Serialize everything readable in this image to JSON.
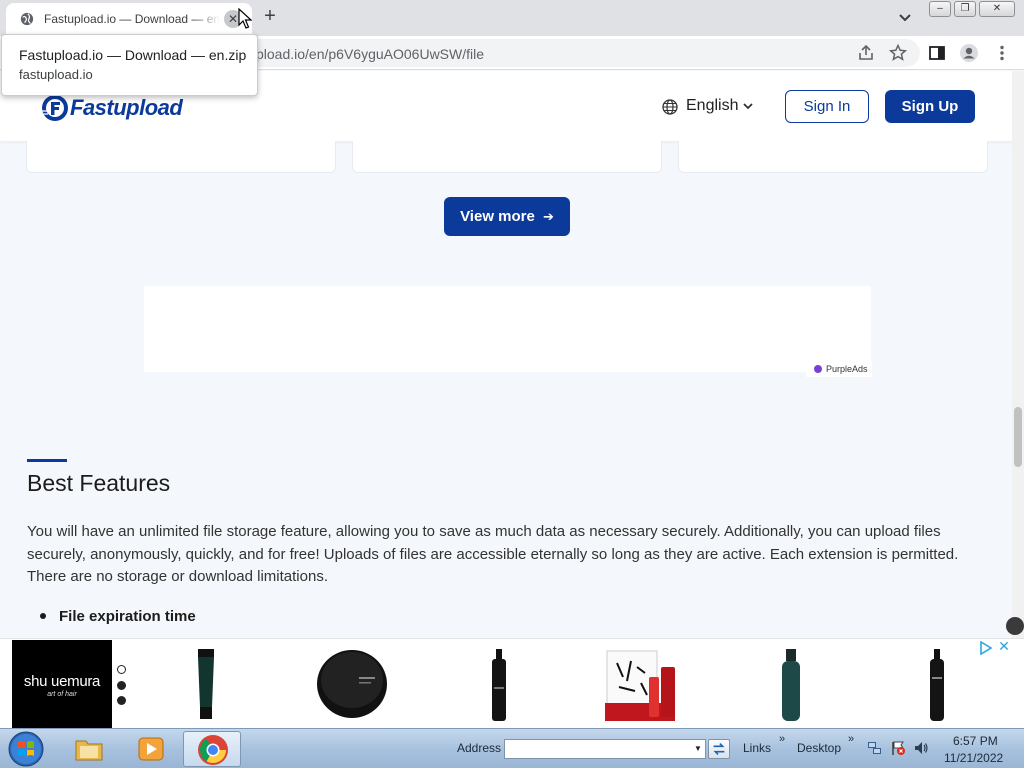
{
  "browser": {
    "tab_title": "Fastupload.io — Download — en.zip",
    "tab_close_glyph": "✕",
    "new_tab_glyph": "+",
    "url_visible": "pload.io/en/p6V6yguAO06UwSW/file",
    "hovercard": {
      "title": "Fastupload.io — Download — en.zip",
      "domain": "fastupload.io"
    },
    "window_controls": {
      "minimize": "–",
      "restore": "❐",
      "close": "✕"
    }
  },
  "site": {
    "logo_text": "Fastupload",
    "language_label": "English",
    "sign_in": "Sign In",
    "sign_up": "Sign Up",
    "view_more": "View more",
    "view_more_arrow": "➔",
    "ad_network": "PurpleAds",
    "features": {
      "title": "Best Features",
      "body": "You will have an unlimited file storage feature, allowing you to save as much data as necessary securely. Additionally, you can upload files securely, anonymously, quickly, and for free! Uploads of files are accessible eternally so long as they are active. Each extension is permitted. There are no storage or download limitations.",
      "list": [
        "File expiration time"
      ]
    }
  },
  "banner_ad": {
    "brand_name": "shu uemura",
    "brand_tagline": "art of hair",
    "close_glyph": "✕"
  },
  "taskbar": {
    "address_label": "Address",
    "links_label": "Links",
    "desktop_label": "Desktop",
    "chevron": "»",
    "time": "6:57 PM",
    "date": "11/21/2022"
  },
  "colors": {
    "brand_blue": "#0b3a9b",
    "page_bg": "#f4f7fb",
    "chrome_gray": "#dfe1e5",
    "ad_accent": "#2aa7e0",
    "purpleads_dot": "#7b3fd6"
  }
}
